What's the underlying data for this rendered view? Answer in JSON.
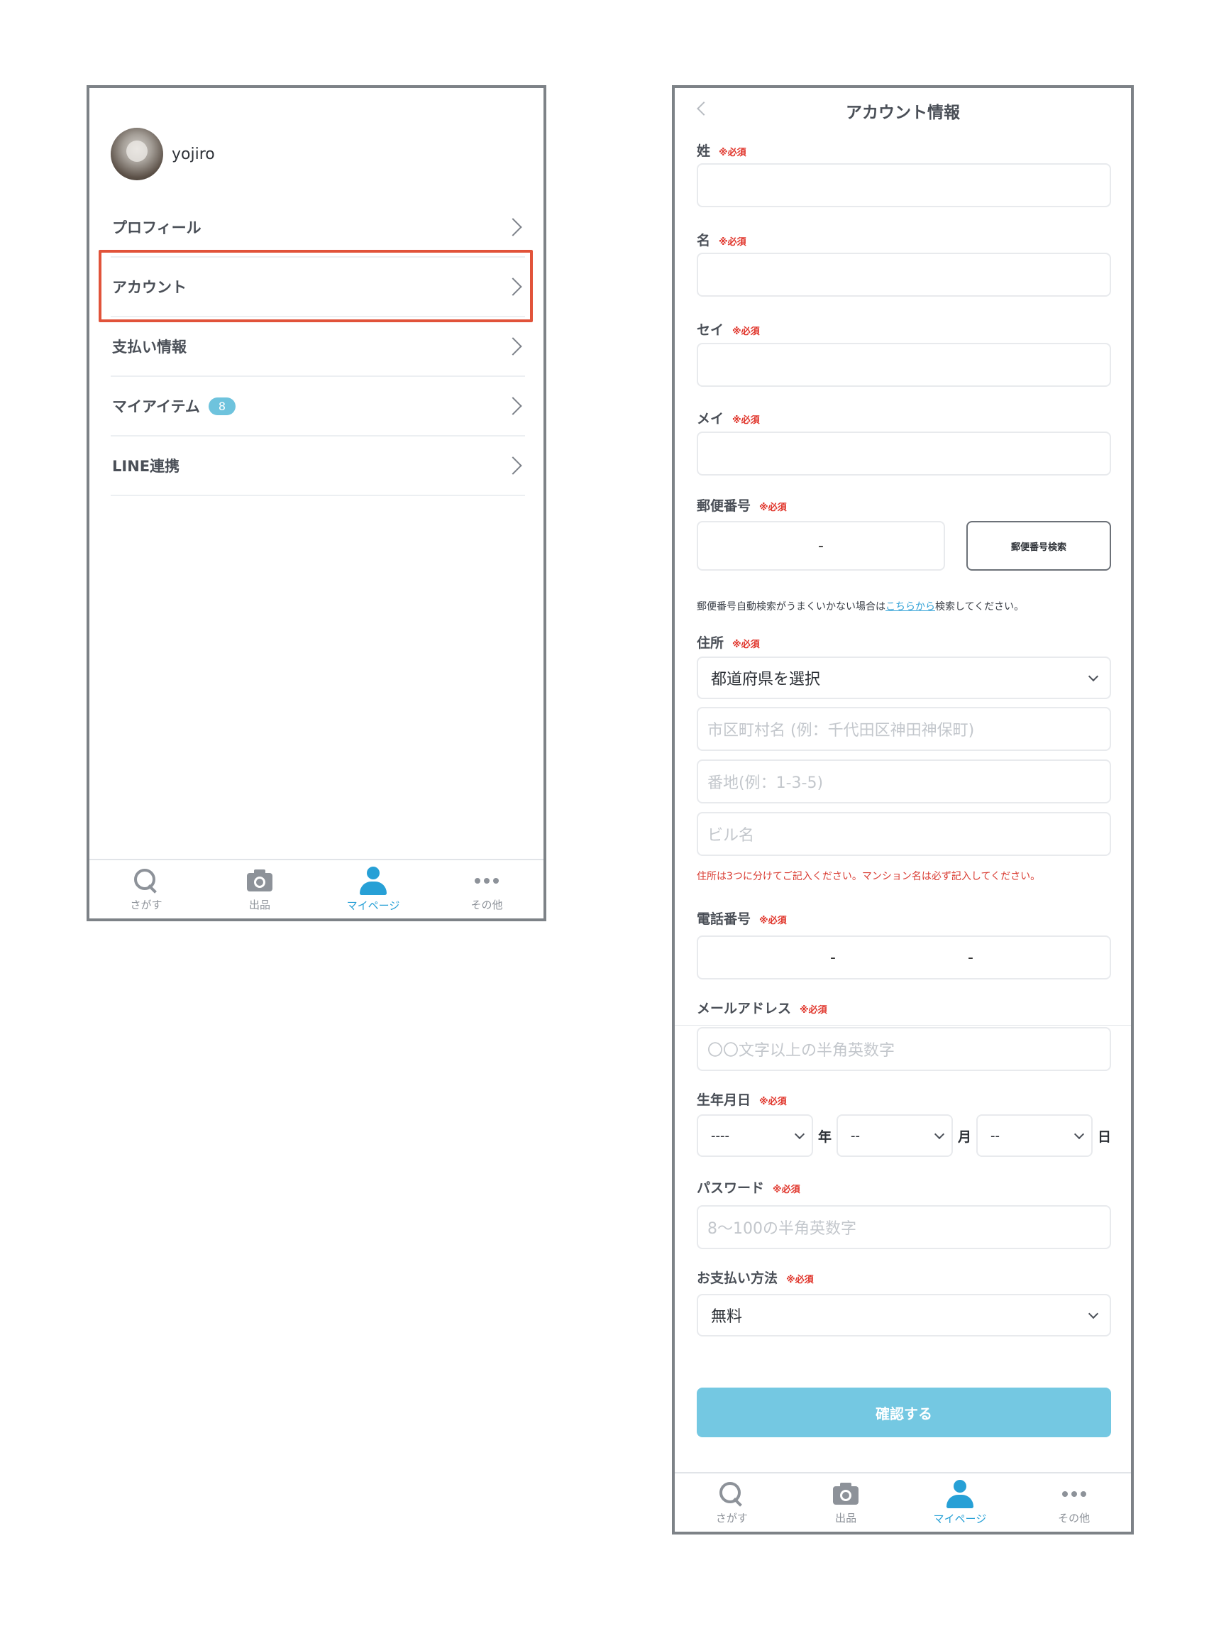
{
  "left": {
    "username": "yojiro",
    "menu": [
      {
        "label": "プロフィール"
      },
      {
        "label": "アカウント"
      },
      {
        "label": "支払い情報"
      },
      {
        "label": "マイアイテム",
        "badge": "8"
      },
      {
        "label": "LINE連携"
      }
    ]
  },
  "tabbar": {
    "search": "さがす",
    "sell": "出品",
    "mypage": "マイページ",
    "other": "その他"
  },
  "right": {
    "title": "アカウント情報",
    "required": "※必須",
    "last_name": "姓",
    "first_name": "名",
    "last_kana": "セイ",
    "first_kana": "メイ",
    "postal": {
      "label": "郵便番号",
      "sep": "-",
      "button": "郵便番号検索",
      "note_before": "郵便番号自動検索がうまくいかない場合は",
      "note_link": "こちらから",
      "note_after": "検索してください。"
    },
    "address": {
      "label": "住所",
      "prefecture": "都道府県を選択",
      "city_placeholder": "市区町村名 (例：千代田区神田神保町)",
      "street_placeholder": "番地(例：1-3-5)",
      "building_placeholder": "ビル名",
      "note": "住所は3つに分けてご記入ください。マンション名は必ず記入してください。"
    },
    "phone": {
      "label": "電話番号",
      "sep1": "-",
      "sep2": "-"
    },
    "email": {
      "label": "メールアドレス",
      "placeholder": "〇〇文字以上の半角英数字"
    },
    "birthday": {
      "label": "生年月日",
      "year": "----",
      "year_unit": "年",
      "month": "--",
      "month_unit": "月",
      "day": "--",
      "day_unit": "日"
    },
    "password": {
      "label": "パスワード",
      "placeholder": "8〜100の半角英数字"
    },
    "payment": {
      "label": "お支払い方法",
      "value": "無料"
    },
    "confirm": "確認する"
  },
  "colors": {
    "accent": "#27a0d6",
    "button": "#74c8e2",
    "required": "#e0342a",
    "highlight": "#e1533a"
  }
}
